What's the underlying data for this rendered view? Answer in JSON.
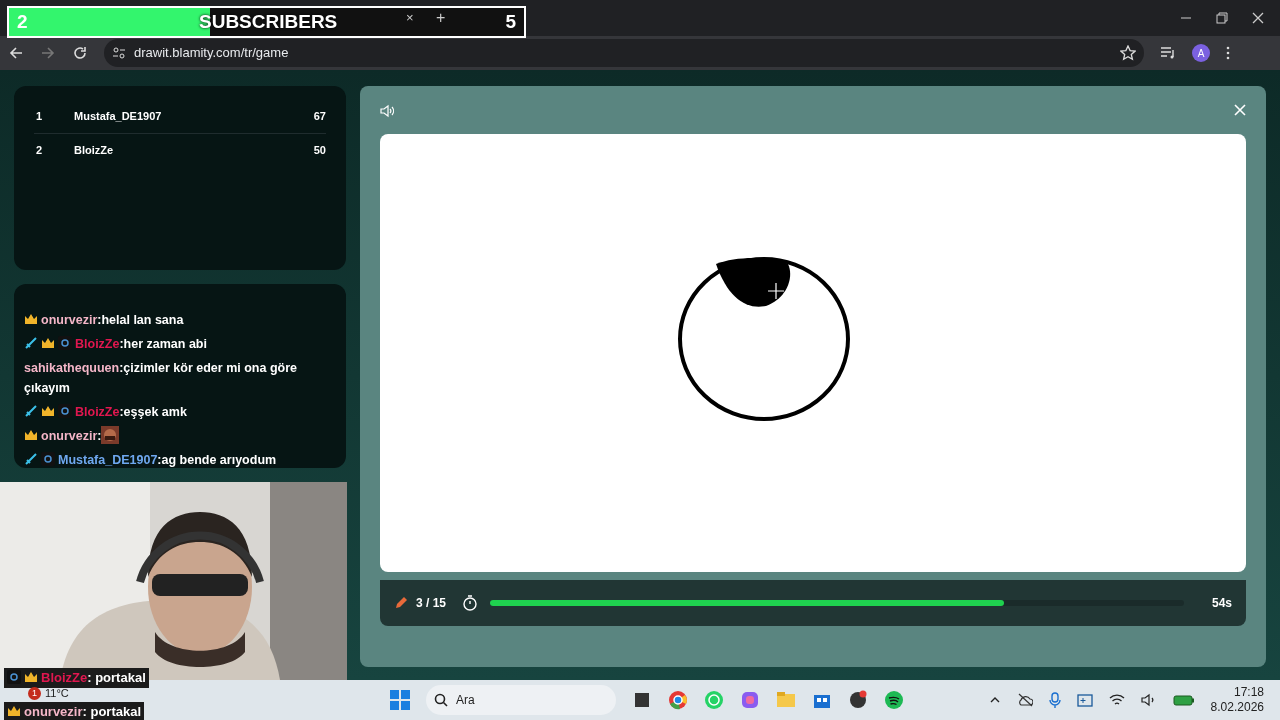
{
  "subscriber_goal": {
    "current": "2",
    "label": "SUBSCRIBERS",
    "target": "5",
    "level": 0.39
  },
  "browser": {
    "tab_close": "×",
    "new_tab": "+",
    "url": "drawit.blamity.com/tr/game",
    "profile": "A"
  },
  "leaderboard": [
    {
      "rank": "1",
      "name": "Mustafa_DE1907",
      "score": "67"
    },
    {
      "rank": "2",
      "name": "BloizZe",
      "score": "50"
    }
  ],
  "chat": [
    {
      "sword": false,
      "crown": true,
      "ds": false,
      "user": "onurvezir",
      "color": "#f4b6c8",
      "kind": "text",
      "text": ":helal lan sana"
    },
    {
      "sword": true,
      "crown": true,
      "ds": true,
      "user": "BloizZe",
      "color": "#e0174f",
      "kind": "text",
      "text": ":her zaman abi"
    },
    {
      "sword": false,
      "crown": false,
      "ds": false,
      "user": "sahikathequuen",
      "color": "#f4b6c8",
      "kind": "text",
      "text": ":çizimler kör eder mi ona göre çıkayım"
    },
    {
      "sword": true,
      "crown": true,
      "ds": true,
      "user": "BloizZe",
      "color": "#e0174f",
      "kind": "text",
      "text": ":eşşek amk"
    },
    {
      "sword": false,
      "crown": true,
      "ds": false,
      "user": "onurvezir",
      "color": "#f4b6c8",
      "kind": "emote",
      "text": ":"
    },
    {
      "sword": true,
      "crown": false,
      "ds": true,
      "user": "Mustafa_DE1907",
      "color": "#6fa8f0",
      "kind": "text",
      "text": ":ag bende arıyodum"
    }
  ],
  "overlay_chat": [
    {
      "user": "BloizZe",
      "color": "#e0174f",
      "text": ": portakal"
    },
    {
      "user": "onurvezir",
      "color": "#f4b6c8",
      "text": ": portakal"
    }
  ],
  "game": {
    "round": "3 / 15",
    "timer": {
      "level": 0.74
    },
    "time_left": "54s"
  },
  "taskbar": {
    "weather_badge": "1",
    "temperature": "11°C",
    "search": "Ara",
    "time": "17:18",
    "date": "8.02.2026"
  }
}
